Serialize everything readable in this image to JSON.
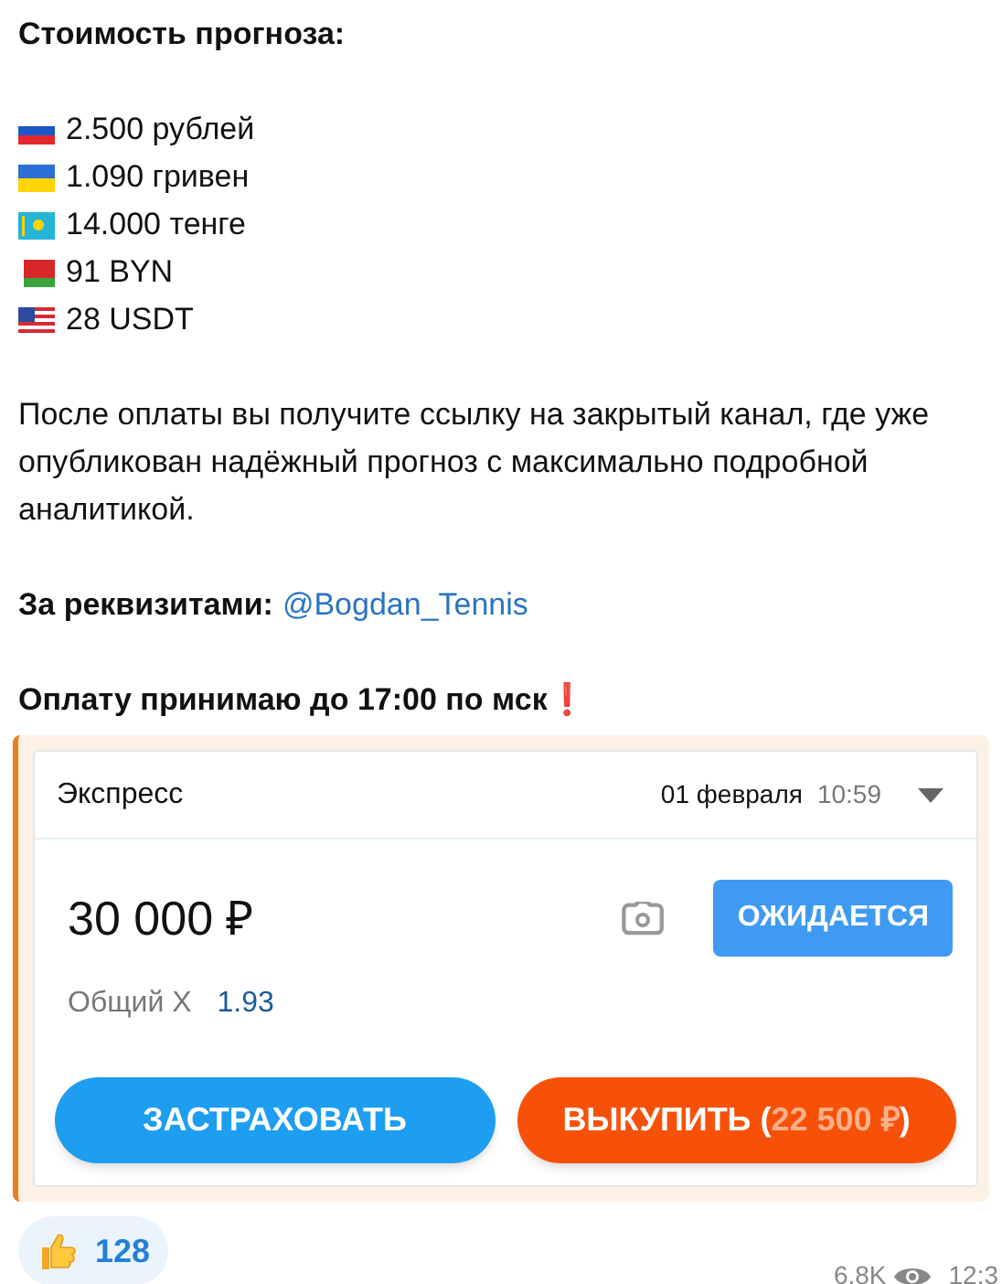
{
  "heading": "Стоимость прогноза:",
  "prices": [
    {
      "kind": "ru",
      "text": "2.500 рублей"
    },
    {
      "kind": "ua",
      "text": "1.090 гривен"
    },
    {
      "kind": "kz",
      "text": "14.000 тенге"
    },
    {
      "kind": "by",
      "text": "91 BYN"
    },
    {
      "kind": "us",
      "text": "28 USDT"
    }
  ],
  "paragraph": "После оплаты вы получите ссылку на закрытый канал, где уже опубликован надёжный прогноз с максимально подробной аналитикой.",
  "requisites": {
    "label": "За реквизитами:",
    "link": "@Bogdan_Tennis"
  },
  "deadline": "Оплату принимаю до 17:00 по мск❗",
  "card": {
    "type": "Экспресс",
    "date": "01 февраля",
    "time": "10:59",
    "amount": "30 000 ₽",
    "status": "ОЖИДАЕТСЯ",
    "odds_label": "Общий Х",
    "odds": "1.93",
    "insure_button": "ЗАСТРАХОВАТЬ",
    "buyout_button": [
      "ВЫКУПИТЬ (",
      "22 500 ₽",
      ")"
    ]
  },
  "reactions": [
    {
      "count": "128"
    }
  ],
  "views": "6.8K",
  "time": "12:3"
}
